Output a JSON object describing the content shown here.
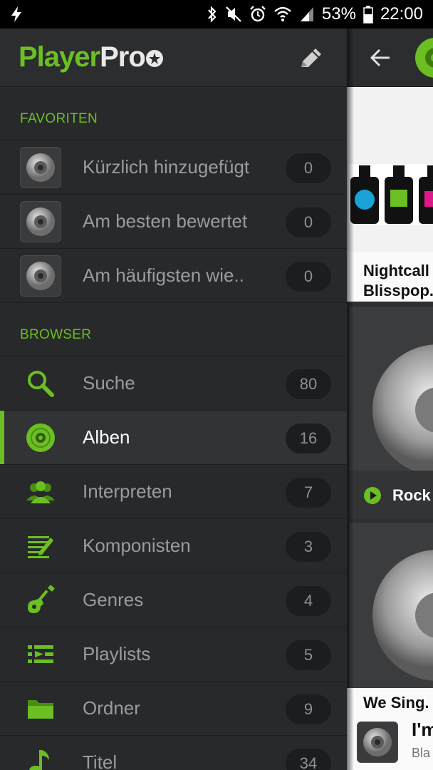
{
  "status_bar": {
    "battery_percent": "53%",
    "time": "22:00",
    "icons": [
      "flash-icon",
      "bluetooth-icon",
      "mute-icon",
      "alarm-icon",
      "wifi-icon",
      "signal-icon",
      "battery-icon"
    ]
  },
  "drawer": {
    "logo": {
      "part1": "Player",
      "part2": "Pro"
    },
    "favorites_title": "FAVORITEN",
    "favorites": [
      {
        "label": "Kürzlich hinzugefügt",
        "count": "0"
      },
      {
        "label": "Am besten bewertet",
        "count": "0"
      },
      {
        "label": "Am häufigsten wie..",
        "count": "0"
      }
    ],
    "browser_title": "BROWSER",
    "browser": [
      {
        "label": "Suche",
        "count": "80",
        "icon": "search-icon"
      },
      {
        "label": "Alben",
        "count": "16",
        "icon": "album-icon",
        "active": true
      },
      {
        "label": "Interpreten",
        "count": "7",
        "icon": "artists-icon"
      },
      {
        "label": "Komponisten",
        "count": "3",
        "icon": "composer-icon"
      },
      {
        "label": "Genres",
        "count": "4",
        "icon": "guitar-icon"
      },
      {
        "label": "Playlists",
        "count": "5",
        "icon": "playlist-icon"
      },
      {
        "label": "Ordner",
        "count": "9",
        "icon": "folder-icon"
      },
      {
        "label": "Titel",
        "count": "34",
        "icon": "music-note-icon"
      }
    ]
  },
  "peek": {
    "album1_line1": "Nightcall",
    "album1_line2": "Blisspop.",
    "album2_label": "Rock",
    "album3_label": "We Sing.",
    "nowplaying_title": "I'm",
    "nowplaying_sub": "Bla"
  },
  "colors": {
    "accent": "#6bbf23",
    "drawer_bg": "#28292b",
    "badge_bg": "#1c1d1e"
  }
}
